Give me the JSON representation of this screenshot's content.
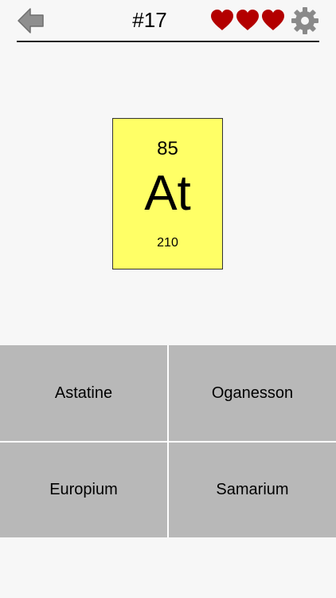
{
  "header": {
    "question_number": "#17",
    "lives": 3,
    "back_icon": "back-arrow-icon",
    "settings_icon": "gear-icon"
  },
  "element": {
    "atomic_number": "85",
    "symbol": "At",
    "atomic_mass": "210",
    "card_color": "#ffff66"
  },
  "answers": [
    {
      "label": "Astatine"
    },
    {
      "label": "Oganesson"
    },
    {
      "label": "Europium"
    },
    {
      "label": "Samarium"
    }
  ],
  "colors": {
    "heart": "#b30000",
    "icon_gray": "#8a8a8a",
    "answer_bg": "#b8b8b8",
    "background": "#f7f7f7"
  }
}
